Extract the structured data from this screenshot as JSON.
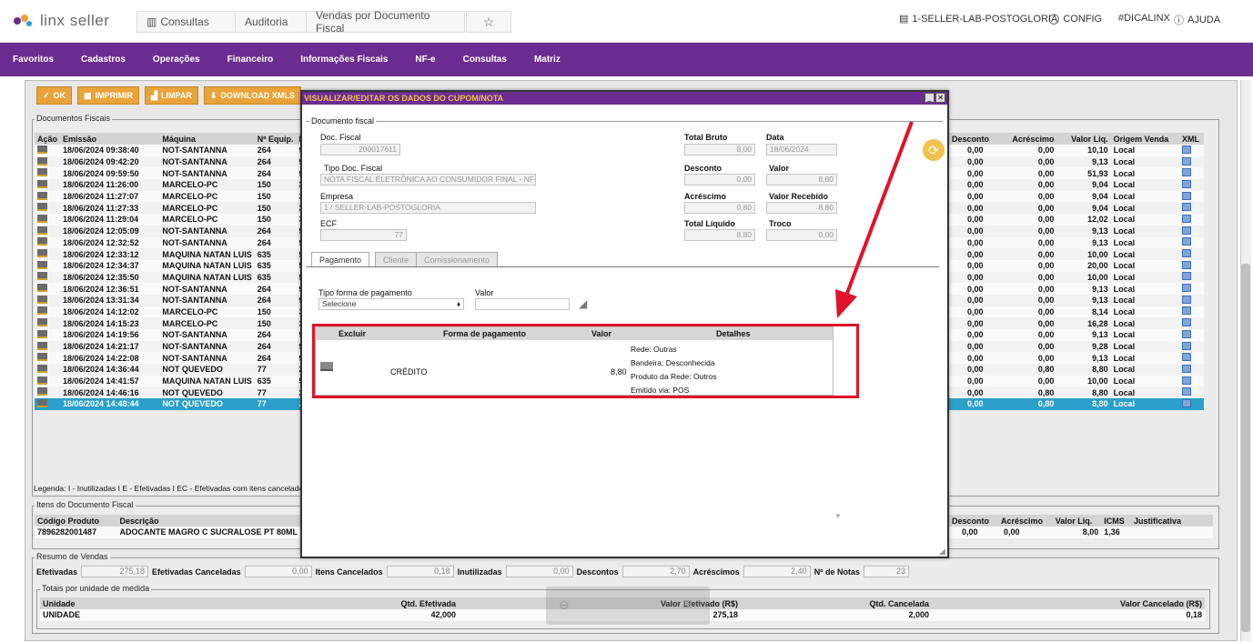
{
  "brand": {
    "name": "linx seller"
  },
  "breadcrumb": [
    "Consultas",
    "Auditoria",
    "Vendas por Documento Fiscal"
  ],
  "topright": {
    "store": "1-SELLER-LAB-POSTOGLORIA",
    "config": "CONFIG",
    "dica": "#DICALINX",
    "help": "AJUDA"
  },
  "menu": [
    "Favoritos",
    "Cadastros",
    "Operações",
    "Financeiro",
    "Informações Fiscais",
    "NF-e",
    "Consultas",
    "Matriz"
  ],
  "toolbar": {
    "ok": "OK",
    "print": "IMPRIMIR",
    "clear": "LIMPAR",
    "download": "DOWNLOAD XMLS"
  },
  "docs": {
    "legend": "Documentos Fiscais",
    "headers_left": [
      "Ação",
      "Emissão",
      "Máquina",
      "Nº Equip.",
      "D"
    ],
    "headers_right": [
      "Desconto",
      "Acréscimo",
      "Valor Liq.",
      "Origem Venda",
      "XML"
    ],
    "rows": [
      {
        "emissao": "18/06/2024 09:38:40",
        "maquina": "NOT-SANTANNA",
        "equip": "264",
        "d": "9",
        "desc": "0,00",
        "acr": "0,00",
        "liq": "10,10",
        "orig": "Local"
      },
      {
        "emissao": "18/06/2024 09:42:20",
        "maquina": "NOT-SANTANNA",
        "equip": "264",
        "d": "9",
        "desc": "0,00",
        "acr": "0,00",
        "liq": "9,13",
        "orig": "Local"
      },
      {
        "emissao": "18/06/2024 09:59:50",
        "maquina": "NOT-SANTANNA",
        "equip": "264",
        "d": "9",
        "desc": "0,00",
        "acr": "0,00",
        "liq": "51,93",
        "orig": "Local"
      },
      {
        "emissao": "18/06/2024 11:26:00",
        "maquina": "MARCELO-PC",
        "equip": "150",
        "d": "3",
        "desc": "0,00",
        "acr": "0,00",
        "liq": "9,04",
        "orig": "Local"
      },
      {
        "emissao": "18/06/2024 11:27:07",
        "maquina": "MARCELO-PC",
        "equip": "150",
        "d": "3",
        "desc": "0,00",
        "acr": "0,00",
        "liq": "9,04",
        "orig": "Local"
      },
      {
        "emissao": "18/06/2024 11:27:33",
        "maquina": "MARCELO-PC",
        "equip": "150",
        "d": "3",
        "desc": "0,00",
        "acr": "0,00",
        "liq": "9,04",
        "orig": "Local"
      },
      {
        "emissao": "18/06/2024 11:29:04",
        "maquina": "MARCELO-PC",
        "equip": "150",
        "d": "3",
        "desc": "0,00",
        "acr": "0,00",
        "liq": "12,02",
        "orig": "Local"
      },
      {
        "emissao": "18/06/2024 12:05:09",
        "maquina": "NOT-SANTANNA",
        "equip": "264",
        "d": "9",
        "desc": "0,00",
        "acr": "0,00",
        "liq": "9,13",
        "orig": "Local"
      },
      {
        "emissao": "18/06/2024 12:32:52",
        "maquina": "NOT-SANTANNA",
        "equip": "264",
        "d": "9",
        "desc": "0,00",
        "acr": "0,00",
        "liq": "9,13",
        "orig": "Local"
      },
      {
        "emissao": "18/06/2024 12:33:12",
        "maquina": "MAQUINA NATAN LUIS",
        "equip": "635",
        "d": "5",
        "desc": "0,00",
        "acr": "0,00",
        "liq": "10,00",
        "orig": "Local"
      },
      {
        "emissao": "18/06/2024 12:34:37",
        "maquina": "MAQUINA NATAN LUIS",
        "equip": "635",
        "d": "5",
        "desc": "0,00",
        "acr": "0,00",
        "liq": "20,00",
        "orig": "Local"
      },
      {
        "emissao": "18/06/2024 12:35:50",
        "maquina": "MAQUINA NATAN LUIS",
        "equip": "635",
        "d": "5",
        "desc": "0,00",
        "acr": "0,00",
        "liq": "10,00",
        "orig": "Local"
      },
      {
        "emissao": "18/06/2024 12:36:51",
        "maquina": "NOT-SANTANNA",
        "equip": "264",
        "d": "9",
        "desc": "0,00",
        "acr": "0,00",
        "liq": "9,13",
        "orig": "Local"
      },
      {
        "emissao": "18/06/2024 13:31:34",
        "maquina": "NOT-SANTANNA",
        "equip": "264",
        "d": "9",
        "desc": "0,00",
        "acr": "0,00",
        "liq": "9,13",
        "orig": "Local"
      },
      {
        "emissao": "18/06/2024 14:12:02",
        "maquina": "MARCELO-PC",
        "equip": "150",
        "d": "3",
        "desc": "0,00",
        "acr": "0,00",
        "liq": "8,14",
        "orig": "Local"
      },
      {
        "emissao": "18/06/2024 14:15:23",
        "maquina": "MARCELO-PC",
        "equip": "150",
        "d": "3",
        "desc": "0,00",
        "acr": "0,00",
        "liq": "16,28",
        "orig": "Local"
      },
      {
        "emissao": "18/06/2024 14:19:56",
        "maquina": "NOT-SANTANNA",
        "equip": "264",
        "d": "9",
        "desc": "0,00",
        "acr": "0,00",
        "liq": "9,13",
        "orig": "Local"
      },
      {
        "emissao": "18/06/2024 14:21:17",
        "maquina": "NOT-SANTANNA",
        "equip": "264",
        "d": "9",
        "desc": "0,00",
        "acr": "0,00",
        "liq": "9,28",
        "orig": "Local"
      },
      {
        "emissao": "18/06/2024 14:22:08",
        "maquina": "NOT-SANTANNA",
        "equip": "264",
        "d": "9",
        "desc": "0,00",
        "acr": "0,00",
        "liq": "9,13",
        "orig": "Local"
      },
      {
        "emissao": "18/06/2024 14:36:44",
        "maquina": "NOT QUEVEDO",
        "equip": "77",
        "d": "2",
        "desc": "0,00",
        "acr": "0,80",
        "liq": "8,80",
        "orig": "Local"
      },
      {
        "emissao": "18/06/2024 14:41:57",
        "maquina": "MAQUINA NATAN LUIS",
        "equip": "635",
        "d": "5",
        "desc": "0,00",
        "acr": "0,00",
        "liq": "10,00",
        "orig": "Local"
      },
      {
        "emissao": "18/06/2024 14:46:16",
        "maquina": "NOT QUEVEDO",
        "equip": "77",
        "d": "2",
        "desc": "0,00",
        "acr": "0,80",
        "liq": "8,80",
        "orig": "Local"
      },
      {
        "emissao": "18/06/2024 14:48:44",
        "maquina": "NOT QUEVEDO",
        "equip": "77",
        "d": "2",
        "desc": "0,00",
        "acr": "0,80",
        "liq": "8,80",
        "orig": "Local"
      }
    ],
    "legenda": "Legenda: I - Inutilizadas I E - Efetivadas I EC - Efetivadas com itens cancelados"
  },
  "items": {
    "legend": "Itens do Documento Fiscal",
    "headers_left": [
      "Código Produto",
      "Descrição"
    ],
    "headers_right": [
      "Desconto",
      "Acréscimo",
      "Valor Liq.",
      "ICMS",
      "Justificativa"
    ],
    "row": {
      "codigo": "7896282001487",
      "descricao": "ADOCANTE MAGRO C SUCRALOSE PT 80ML",
      "desc": "0,00",
      "acr": "0,00",
      "liq": "8,00",
      "icms": "1,36"
    }
  },
  "resumo": {
    "legend": "Resumo de Vendas",
    "efetivadas_l": "Efetivadas",
    "efetivadas_v": "275,18",
    "efcanc_l": "Efetivadas Canceladas",
    "efcanc_v": "0,00",
    "itcanc_l": "Itens Cancelados",
    "itcanc_v": "0,18",
    "inut_l": "Inutilizadas",
    "inut_v": "0,00",
    "descontos_l": "Descontos",
    "descontos_v": "2,70",
    "acresc_l": "Acréscimos",
    "acresc_v": "2,40",
    "notas_l": "Nº de Notas",
    "notas_v": "23"
  },
  "totais": {
    "legend": "Totais por unidade de medida",
    "headers": [
      "Unidade",
      "Qtd. Efetivada",
      "Valor Efetivado (R$)",
      "Qtd. Cancelada",
      "Valor Cancelado (R$)"
    ],
    "row": [
      "UNIDADE",
      "42,000",
      "275,18",
      "2,000",
      "0,18"
    ]
  },
  "modal": {
    "title": "VISUALIZAR/EDITAR OS DADOS DO CUPOM/NOTA",
    "fieldset": "Documento fiscal",
    "doc_fiscal_l": "Doc. Fiscal",
    "doc_fiscal_v": "200017611",
    "tipo_doc_l": "Tipo Doc. Fiscal",
    "tipo_doc_v": "NOTA FISCAL ELETRÔNICA AO CONSUMIDOR FINAL - NFC-E",
    "empresa_l": "Empresa",
    "empresa_v": "1 / SELLER-LAB-POSTOGLORIA",
    "ecf_l": "ECF",
    "ecf_v": "77",
    "total_bruto_l": "Total Bruto",
    "total_bruto_v": "8,00",
    "desconto_l": "Desconto",
    "desconto_v": "0,00",
    "acrescimo_l": "Acréscimo",
    "acrescimo_v": "0,80",
    "total_liq_l": "Total Líquido",
    "total_liq_v": "8,80",
    "data_l": "Data",
    "data_v": "18/06/2024",
    "valor_l": "Valor",
    "valor_v": "8,80",
    "valor_rec_l": "Valor Recebido",
    "valor_rec_v": "8,80",
    "troco_l": "Troco",
    "troco_v": "0,00",
    "tabs": [
      "Pagamento",
      "Cliente",
      "Comissionamento"
    ],
    "tipo_forma_l": "Tipo forma de pagamento",
    "tipo_forma_v": "Selecione",
    "valor2_l": "Valor",
    "pay_headers": [
      "Excluir",
      "Forma de pagamento",
      "Valor",
      "Detalhes"
    ],
    "pay_row": {
      "forma": "CRÉDITO",
      "valor": "8,80",
      "det1": "Rede: Outras",
      "det2": "Bandeira: Desconhecida",
      "det3": "Produto da Rede: Outros",
      "det4": "Emitido via: POS"
    }
  },
  "colors": {
    "purple": "#6b2c91",
    "orange": "#e8a33b",
    "select": "#2a9fc9",
    "red": "#e0122a"
  }
}
